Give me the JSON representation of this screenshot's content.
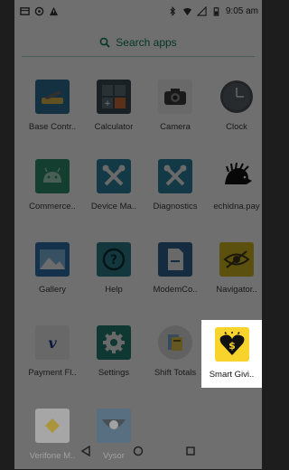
{
  "status_bar": {
    "time": "9:05 am",
    "left_icons": [
      "storage-icon",
      "circle-icon",
      "warning-icon"
    ],
    "right_icons": [
      "bluetooth-icon",
      "wifi-icon",
      "signal-icon",
      "battery-icon"
    ]
  },
  "search": {
    "placeholder": "Search apps",
    "icon": "search-icon"
  },
  "apps": [
    {
      "label": "Base Contr..",
      "icon": "base-control-icon"
    },
    {
      "label": "Calculator",
      "icon": "calculator-icon"
    },
    {
      "label": "Camera",
      "icon": "camera-icon"
    },
    {
      "label": "Clock",
      "icon": "clock-icon"
    },
    {
      "label": "Commerce..",
      "icon": "android-icon"
    },
    {
      "label": "Device Ma..",
      "icon": "tools-icon"
    },
    {
      "label": "Diagnostics",
      "icon": "diagnostics-tools-icon"
    },
    {
      "label": "echidna.pay",
      "icon": "echidna-icon"
    },
    {
      "label": "Gallery",
      "icon": "gallery-icon"
    },
    {
      "label": "Help",
      "icon": "help-icon"
    },
    {
      "label": "ModemCo..",
      "icon": "modem-icon"
    },
    {
      "label": "Navigator..",
      "icon": "navigator-eye-icon"
    },
    {
      "label": "Payment Fl..",
      "icon": "payment-flow-icon"
    },
    {
      "label": "Settings",
      "icon": "settings-gear-icon"
    },
    {
      "label": "Shift Totals",
      "icon": "shift-totals-icon"
    },
    {
      "label": "Smart Givi..",
      "icon": "smart-giving-heart-icon"
    },
    {
      "label": "Verifone M..",
      "icon": "verifone-icon"
    },
    {
      "label": "Vysor",
      "icon": "vysor-icon"
    }
  ],
  "nav": {
    "back": "back-icon",
    "home": "home-icon",
    "recents": "recents-icon"
  }
}
